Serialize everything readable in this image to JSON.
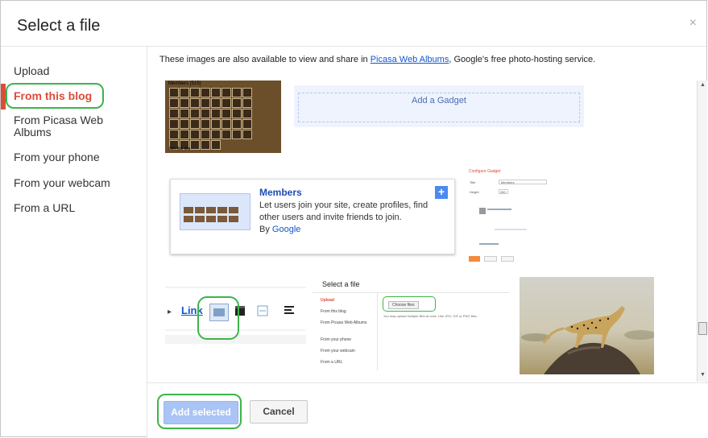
{
  "dialog": {
    "title": "Select a file",
    "close": "×"
  },
  "sidebar": {
    "items": [
      {
        "label": "Upload"
      },
      {
        "label": "From this blog"
      },
      {
        "label": "From Picasa Web Albums"
      },
      {
        "label": "From your phone"
      },
      {
        "label": "From your webcam"
      },
      {
        "label": "From a URL"
      }
    ],
    "active": "From this blog"
  },
  "notice": {
    "prefix": "These images are also available to view and share in ",
    "link": "Picasa Web Albums",
    "suffix": ", Google's free photo-hosting service."
  },
  "thumbnails": {
    "members_gadget": {
      "title": "Members (515)",
      "footer": "Join this site"
    },
    "add_gadget": {
      "label": "Add a Gadget"
    },
    "members_card": {
      "heading": "Members",
      "description": "Let users join your site, create profiles, find other users and invite friends to join.",
      "by": "By",
      "by_name": "Google",
      "plus": "+"
    },
    "configure_gadget": {
      "heading": "Configure Gadget",
      "title_label": "Title",
      "title_value": "Members",
      "height_label": "Height",
      "height_value": "260"
    },
    "toolbar": {
      "link": "Link"
    },
    "select_file_preview": {
      "title": "Select a file",
      "items": [
        "Upload",
        "From this blog",
        "From Picasa Web Albums",
        "From your phone",
        "From your webcam",
        "From a URL"
      ],
      "choose": "Choose files",
      "hint": "You may upload multiple files at once. Use JPG, GIF or PNG files."
    }
  },
  "footer": {
    "add_selected": "Add selected",
    "cancel": "Cancel"
  },
  "colors": {
    "accent_red": "#dd4b39",
    "link_blue": "#1155cc",
    "highlight_green": "#3cb54a",
    "add_button": "#a9c4f5"
  }
}
